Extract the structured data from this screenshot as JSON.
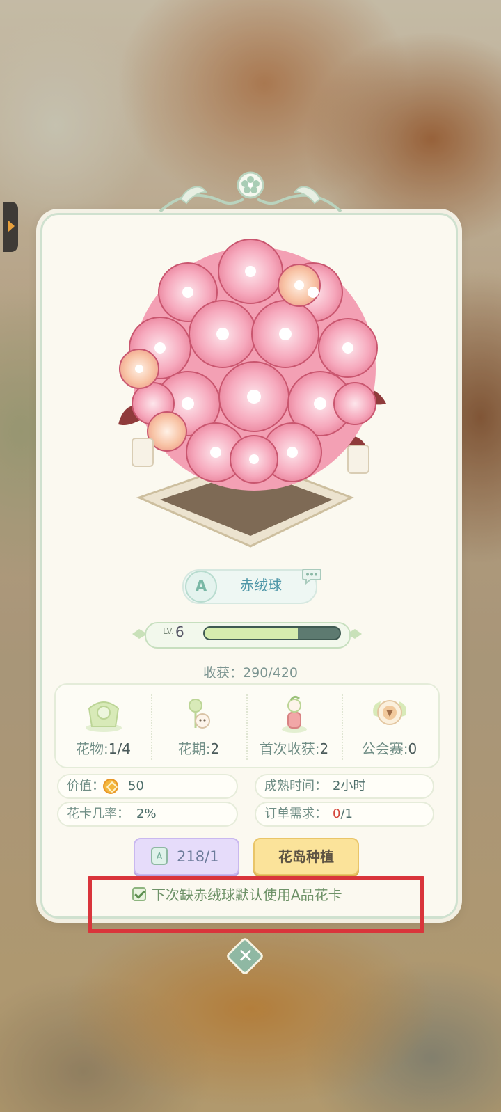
{
  "flower": {
    "grade": "A",
    "name": "赤绒球"
  },
  "level": {
    "prefix": "LV.",
    "value": "6",
    "progress_fraction": 0.69
  },
  "harvest": {
    "text": "收获：290/420"
  },
  "stats": [
    {
      "label": "花物:",
      "value": "1/4",
      "icon": "flower-object-icon"
    },
    {
      "label": "花期:",
      "value": "2",
      "icon": "flower-period-icon"
    },
    {
      "label": "首次收获:",
      "value": "2",
      "icon": "first-harvest-icon"
    },
    {
      "label": "公会赛:",
      "value": "0",
      "icon": "guild-race-icon"
    }
  ],
  "info": {
    "value_label": "价值：",
    "value_amount": "50",
    "mature_label": "成熟时间：",
    "mature_value": "2小时",
    "card_rate_label": "花卡几率：",
    "card_rate_value": "2%",
    "order_label": "订单需求：",
    "order_have": "0",
    "order_need": "/1"
  },
  "buttons": {
    "card_count": "218/1",
    "plant": "花岛种植"
  },
  "checkbox": {
    "checked": true,
    "label": "下次缺赤绒球默认使用A品花卡"
  },
  "colors": {
    "card_bg": "#fbf9f0",
    "accent_green": "#8fb8a3",
    "highlight_red": "#d9353b",
    "plant_button": "#fbe39a",
    "card_button": "#e6dcfa"
  }
}
